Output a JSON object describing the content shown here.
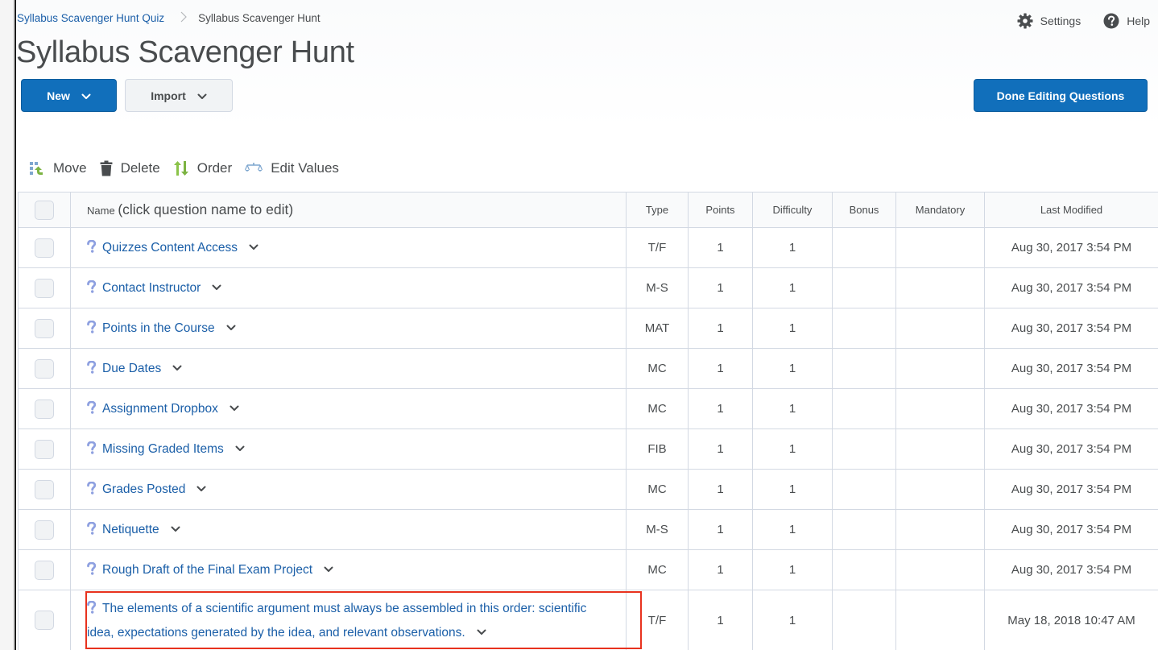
{
  "breadcrumb": {
    "parent": "Syllabus Scavenger Hunt Quiz",
    "separator": "›",
    "current": "Syllabus Scavenger Hunt"
  },
  "page_title": "Syllabus Scavenger Hunt",
  "header_links": {
    "settings": "Settings",
    "help": "Help"
  },
  "buttons": {
    "new": "New",
    "import": "Import",
    "done": "Done Editing Questions"
  },
  "toolbar": {
    "move": "Move",
    "delete": "Delete",
    "order": "Order",
    "edit_values": "Edit Values"
  },
  "table": {
    "headers": {
      "name": "Name",
      "name_hint": "(click question name to edit)",
      "type": "Type",
      "points": "Points",
      "difficulty": "Difficulty",
      "bonus": "Bonus",
      "mandatory": "Mandatory",
      "last_modified": "Last Modified"
    },
    "rows": [
      {
        "name": "Quizzes Content Access",
        "type": "T/F",
        "points": "1",
        "difficulty": "1",
        "bonus": "",
        "mandatory": "",
        "last_modified": "Aug 30, 2017 3:54 PM"
      },
      {
        "name": "Contact Instructor",
        "type": "M-S",
        "points": "1",
        "difficulty": "1",
        "bonus": "",
        "mandatory": "",
        "last_modified": "Aug 30, 2017 3:54 PM"
      },
      {
        "name": "Points in the Course",
        "type": "MAT",
        "points": "1",
        "difficulty": "1",
        "bonus": "",
        "mandatory": "",
        "last_modified": "Aug 30, 2017 3:54 PM"
      },
      {
        "name": "Due Dates",
        "type": "MC",
        "points": "1",
        "difficulty": "1",
        "bonus": "",
        "mandatory": "",
        "last_modified": "Aug 30, 2017 3:54 PM"
      },
      {
        "name": "Assignment Dropbox",
        "type": "MC",
        "points": "1",
        "difficulty": "1",
        "bonus": "",
        "mandatory": "",
        "last_modified": "Aug 30, 2017 3:54 PM"
      },
      {
        "name": "Missing Graded Items",
        "type": "FIB",
        "points": "1",
        "difficulty": "1",
        "bonus": "",
        "mandatory": "",
        "last_modified": "Aug 30, 2017 3:54 PM"
      },
      {
        "name": "Grades Posted",
        "type": "MC",
        "points": "1",
        "difficulty": "1",
        "bonus": "",
        "mandatory": "",
        "last_modified": "Aug 30, 2017 3:54 PM"
      },
      {
        "name": "Netiquette",
        "type": "M-S",
        "points": "1",
        "difficulty": "1",
        "bonus": "",
        "mandatory": "",
        "last_modified": "Aug 30, 2017 3:54 PM"
      },
      {
        "name": "Rough Draft of the Final Exam Project",
        "type": "MC",
        "points": "1",
        "difficulty": "1",
        "bonus": "",
        "mandatory": "",
        "last_modified": "Aug 30, 2017 3:54 PM"
      },
      {
        "name": "The elements of a scientific argument must always be assembled in this order: scientific idea, expectations generated by the idea, and relevant observations.",
        "type": "T/F",
        "points": "1",
        "difficulty": "1",
        "bonus": "",
        "mandatory": "",
        "last_modified": "May 18, 2018 10:47 AM",
        "highlighted": true
      }
    ]
  },
  "colors": {
    "primary": "#116fbb",
    "link": "#1b5fa8",
    "text": "#494c4e",
    "border": "#d3d9e3",
    "highlight": "#e8321e",
    "question_icon": "#8ea0e0"
  }
}
